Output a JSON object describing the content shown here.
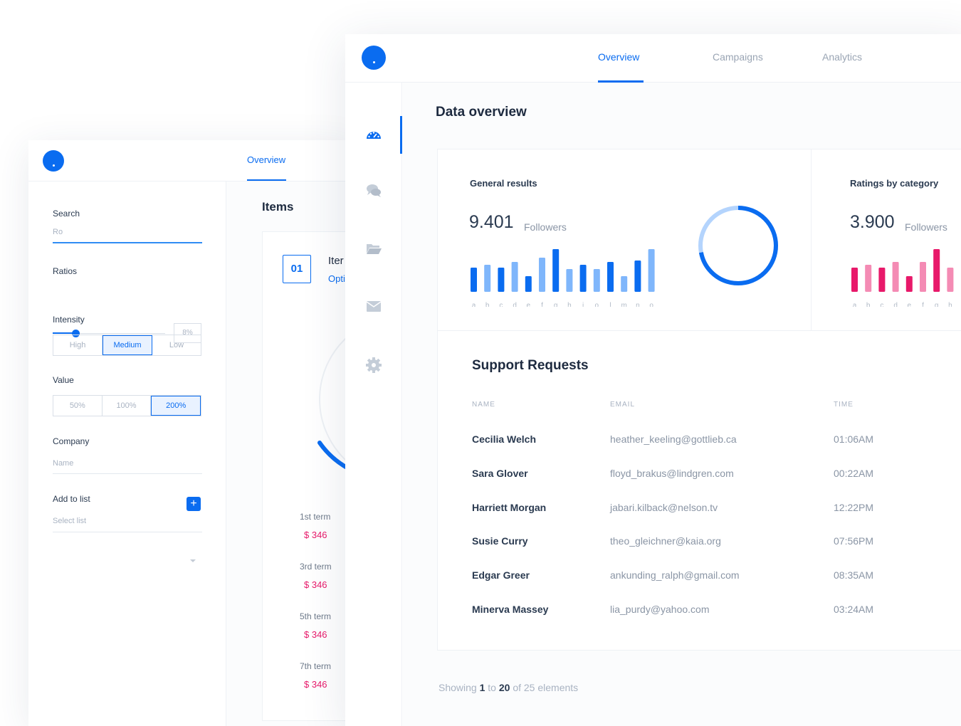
{
  "back_panel": {
    "tab_overview": "Overview",
    "form": {
      "search_label": "Search",
      "search_value": "Ro",
      "ratios_label": "Ratios",
      "ratio_level": 0.2,
      "ratio_value": "8%",
      "intensity_label": "Intensity",
      "intensity_options": [
        "High",
        "Medium",
        "Low"
      ],
      "intensity_selected": "Medium",
      "value_label": "Value",
      "value_options": [
        "50%",
        "100%",
        "200%"
      ],
      "value_selected": "200%",
      "company_label": "Company",
      "company_placeholder": "Name",
      "add_button": "+",
      "add_to_list_label": "Add to list",
      "select_placeholder": "Select list"
    },
    "items": {
      "title": "Items",
      "badge": "01",
      "item_name": "Iter",
      "item_option": "Opti",
      "terms": [
        {
          "label": "1st term",
          "value": "$ 346"
        },
        {
          "label": "3rd term",
          "value": "$ 346"
        },
        {
          "label": "5th term",
          "value": "$ 346"
        },
        {
          "label": "7th term",
          "value": "$ 346"
        }
      ]
    }
  },
  "front_panel": {
    "tabs": [
      "Overview",
      "Campaigns",
      "Analytics"
    ],
    "active_tab": "Overview",
    "sidebar_icons": [
      "dashboard-icon",
      "chat-icon",
      "folder-icon",
      "mail-icon",
      "gear-icon"
    ],
    "page_title": "Data overview",
    "general": {
      "title": "General results",
      "value": "9.401",
      "unit": "Followers",
      "donut_fraction": 0.72
    },
    "ratings": {
      "title": "Ratings by category",
      "value": "3.900",
      "unit": "Followers"
    },
    "support": {
      "title": "Support Requests",
      "headers": [
        "NAME",
        "EMAIL",
        "TIME"
      ],
      "rows": [
        {
          "name": "Cecilia Welch",
          "email": "heather_keeling@gottlieb.ca",
          "time": "01:06AM"
        },
        {
          "name": "Sara Glover",
          "email": "floyd_brakus@lindgren.com",
          "time": "00:22AM"
        },
        {
          "name": "Harriett Morgan",
          "email": "jabari.kilback@nelson.tv",
          "time": "12:22PM"
        },
        {
          "name": "Susie Curry",
          "email": "theo_gleichner@kaia.org",
          "time": "07:56PM"
        },
        {
          "name": "Edgar Greer",
          "email": "ankunding_ralph@gmail.com",
          "time": "08:35AM"
        },
        {
          "name": "Minerva Massey",
          "email": "lia_purdy@yahoo.com",
          "time": "03:24AM"
        }
      ]
    },
    "footer": {
      "showing": "Showing",
      "from": "1",
      "to_word": "to",
      "to": "20",
      "of_word": "of 25 elements"
    }
  },
  "chart_data": [
    {
      "type": "bar",
      "categories": [
        "a",
        "b",
        "c",
        "d",
        "e",
        "f",
        "g",
        "h",
        "i",
        "o",
        "l",
        "m",
        "n",
        "o"
      ],
      "values": [
        34,
        38,
        34,
        42,
        22,
        48,
        60,
        32,
        38,
        32,
        42,
        22,
        44,
        60
      ],
      "colors": [
        "#0a6cf0",
        "#7fb6fb"
      ],
      "ylim": [
        0,
        60
      ]
    },
    {
      "type": "bar",
      "categories": [
        "a",
        "b",
        "c",
        "d",
        "e",
        "f",
        "g",
        "h"
      ],
      "values": [
        34,
        38,
        34,
        42,
        22,
        42,
        60,
        34
      ],
      "colors": [
        "#e8196a",
        "#f48bb4"
      ],
      "ylim": [
        0,
        60
      ]
    }
  ]
}
